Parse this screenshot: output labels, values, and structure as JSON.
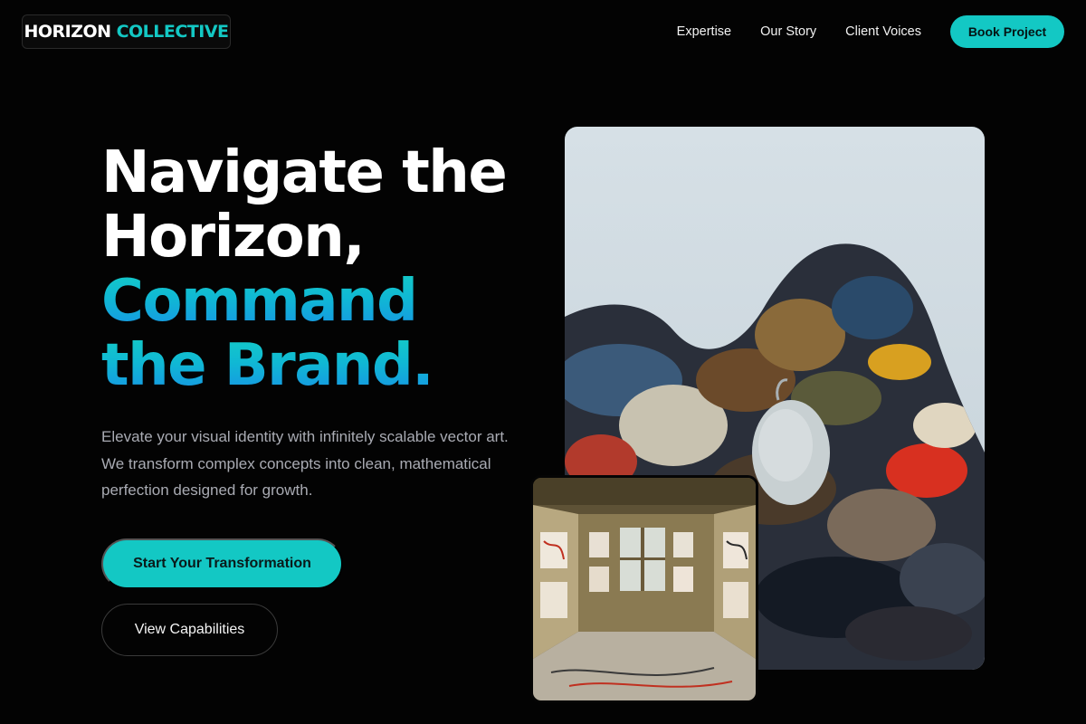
{
  "brand": {
    "word1": "HORIZON",
    "word2": "COLLECTIVE"
  },
  "nav": {
    "items": [
      "Expertise",
      "Our Story",
      "Client Voices"
    ],
    "cta": "Book Project"
  },
  "hero": {
    "line1": "Navigate the",
    "line2": "Horizon,",
    "line3": "Command",
    "line4": "the Brand.",
    "subtitle": "Elevate your visual identity with infinitely scalable vector art. We transform complex concepts into clean, mathematical perfection designed for growth.",
    "primary_cta": "Start Your Transformation",
    "secondary_cta": "View Capabilities"
  },
  "colors": {
    "accent": "#13c8c4",
    "gradient_end": "#1790e6",
    "background": "#030303"
  },
  "images": {
    "main": "paint-palette-photo",
    "inset": "art-studio-photo"
  }
}
